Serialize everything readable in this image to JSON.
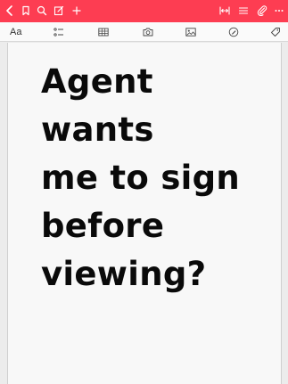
{
  "top_bar": {
    "accent_color": "#fd3d52",
    "icons": [
      "back-icon",
      "bookmark-icon",
      "search-icon",
      "compose-icon",
      "add-icon",
      "resize-icon",
      "list-icon",
      "attachment-icon",
      "more-icon"
    ]
  },
  "format_toolbar": {
    "text_style_label": "Aa",
    "icons": [
      "checklist-icon",
      "table-icon",
      "camera-icon",
      "image-icon",
      "sketch-icon",
      "tag-icon"
    ]
  },
  "note": {
    "lines": [
      "Agent",
      "wants",
      "me to sign",
      "before",
      "viewing?"
    ]
  }
}
